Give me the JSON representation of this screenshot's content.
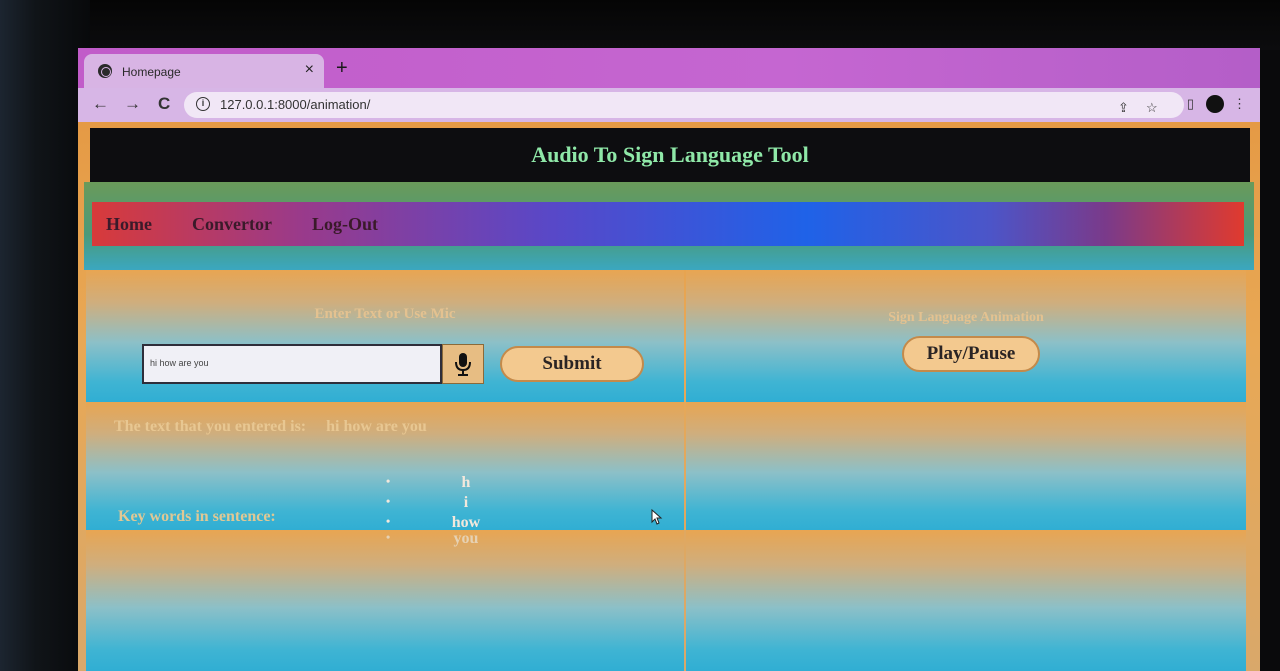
{
  "browser": {
    "tab_title": "Homepage",
    "tab_close": "×",
    "new_tab": "+",
    "back": "←",
    "forward": "→",
    "reload": "C",
    "url": "127.0.0.1:8000/animation/"
  },
  "header": {
    "title": "Audio To Sign Language Tool"
  },
  "nav": {
    "items": [
      "Home",
      "Convertor",
      "Log-Out"
    ]
  },
  "left_panel": {
    "heading": "Enter Text or Use Mic",
    "input_value": "hi how are you",
    "submit_label": "Submit",
    "entered_label": "The text that you entered is:",
    "entered_value": "hi how are you",
    "keywords_label": "Key words in sentence:",
    "keywords": [
      "h",
      "i",
      "how",
      "you"
    ]
  },
  "right_panel": {
    "heading": "Sign Language Animation",
    "play_label": "Play/Pause"
  },
  "colors": {
    "header_bg": "#0d0d10",
    "title_text": "#8fe8a8",
    "button_bg": "#f3c98f"
  }
}
